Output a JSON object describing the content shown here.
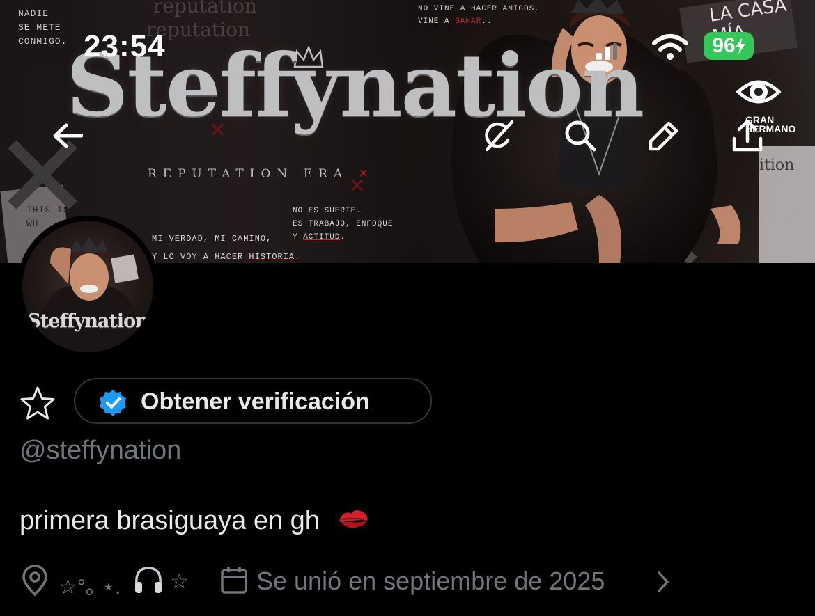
{
  "status_bar": {
    "time": "23:54",
    "battery": "96"
  },
  "banner": {
    "title": "Steffynation",
    "subtitle": "REPUTATION ERA",
    "tagline_left_1": "NADIE\nSE METE\nCONMIGO.",
    "tagline_top": "NO VINE A HACER AMIGOS,\nVINE A ",
    "tagline_top_red": "GANAR",
    "tagline_mid": "MI VERDAD, MI CAMINO,\nY LO VOY A HACER ",
    "tagline_mid_red": "HISTORIA",
    "tagline_right": "NO ES SUERTE.\nES TRABAJO, ENFOQUE\nY ",
    "tagline_right_red": "ACTITUD",
    "note": "THIS IS\nWH",
    "casa": "LA CASA\nMÍA.",
    "show_logo": "GRAN\nHERMANO"
  },
  "nav": {
    "back": "back-arrow-icon",
    "grok": "grok-icon",
    "search": "search-icon",
    "edit": "pencil-icon",
    "share": "share-icon"
  },
  "avatar": {
    "name": "Steffynation"
  },
  "profile": {
    "verify_label": "Obtener verificación",
    "handle": "@steffynation",
    "bio": "primera brasiguaya en gh",
    "location": "☆°｡ ⋆.",
    "location_end": "☆",
    "joined": "Se unió en septiembre de 2025"
  },
  "colors": {
    "background": "#000000",
    "text_primary": "#e7e9ea",
    "text_secondary": "#71767b",
    "verified_blue": "#1d9bf0",
    "battery_green": "#34c759",
    "border": "#333639"
  }
}
